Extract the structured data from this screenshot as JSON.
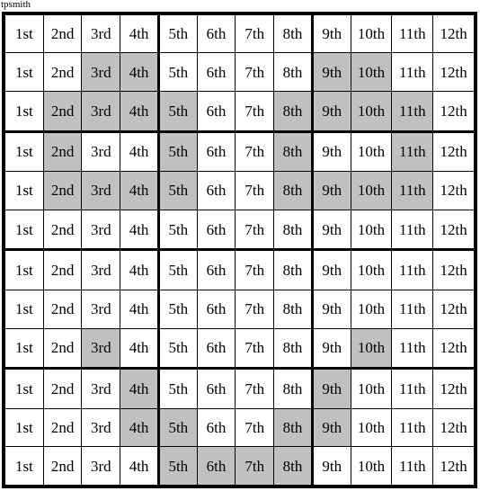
{
  "caption": "tpsmith",
  "colors": {
    "shaded": "#c0c0c0",
    "unshaded": "#ffffff",
    "border": "#000000"
  },
  "grid": {
    "rows": 12,
    "columns": 12,
    "column_labels": [
      "1st",
      "2nd",
      "3rd",
      "4th",
      "5th",
      "6th",
      "7th",
      "8th",
      "9th",
      "10th",
      "11th",
      "12th"
    ],
    "thick_column_separators_after": [
      4,
      8
    ],
    "thick_row_separators_after": [
      3,
      6,
      9
    ],
    "cells": [
      [
        {
          "label": "1st",
          "shaded": false
        },
        {
          "label": "2nd",
          "shaded": false
        },
        {
          "label": "3rd",
          "shaded": false
        },
        {
          "label": "4th",
          "shaded": false
        },
        {
          "label": "5th",
          "shaded": false
        },
        {
          "label": "6th",
          "shaded": false
        },
        {
          "label": "7th",
          "shaded": false
        },
        {
          "label": "8th",
          "shaded": false
        },
        {
          "label": "9th",
          "shaded": false
        },
        {
          "label": "10th",
          "shaded": false
        },
        {
          "label": "11th",
          "shaded": false
        },
        {
          "label": "12th",
          "shaded": false
        }
      ],
      [
        {
          "label": "1st",
          "shaded": false
        },
        {
          "label": "2nd",
          "shaded": false
        },
        {
          "label": "3rd",
          "shaded": true
        },
        {
          "label": "4th",
          "shaded": true
        },
        {
          "label": "5th",
          "shaded": false
        },
        {
          "label": "6th",
          "shaded": false
        },
        {
          "label": "7th",
          "shaded": false
        },
        {
          "label": "8th",
          "shaded": false
        },
        {
          "label": "9th",
          "shaded": true
        },
        {
          "label": "10th",
          "shaded": true
        },
        {
          "label": "11th",
          "shaded": false
        },
        {
          "label": "12th",
          "shaded": false
        }
      ],
      [
        {
          "label": "1st",
          "shaded": false
        },
        {
          "label": "2nd",
          "shaded": true
        },
        {
          "label": "3rd",
          "shaded": true
        },
        {
          "label": "4th",
          "shaded": true
        },
        {
          "label": "5th",
          "shaded": true
        },
        {
          "label": "6th",
          "shaded": false
        },
        {
          "label": "7th",
          "shaded": false
        },
        {
          "label": "8th",
          "shaded": true
        },
        {
          "label": "9th",
          "shaded": true
        },
        {
          "label": "10th",
          "shaded": true
        },
        {
          "label": "11th",
          "shaded": true
        },
        {
          "label": "12th",
          "shaded": false
        }
      ],
      [
        {
          "label": "1st",
          "shaded": false
        },
        {
          "label": "2nd",
          "shaded": true
        },
        {
          "label": "3rd",
          "shaded": false
        },
        {
          "label": "4th",
          "shaded": false
        },
        {
          "label": "5th",
          "shaded": true
        },
        {
          "label": "6th",
          "shaded": false
        },
        {
          "label": "7th",
          "shaded": false
        },
        {
          "label": "8th",
          "shaded": true
        },
        {
          "label": "9th",
          "shaded": false
        },
        {
          "label": "10th",
          "shaded": false
        },
        {
          "label": "11th",
          "shaded": true
        },
        {
          "label": "12th",
          "shaded": false
        }
      ],
      [
        {
          "label": "1st",
          "shaded": false
        },
        {
          "label": "2nd",
          "shaded": true
        },
        {
          "label": "3rd",
          "shaded": true
        },
        {
          "label": "4th",
          "shaded": true
        },
        {
          "label": "5th",
          "shaded": true
        },
        {
          "label": "6th",
          "shaded": false
        },
        {
          "label": "7th",
          "shaded": false
        },
        {
          "label": "8th",
          "shaded": true
        },
        {
          "label": "9th",
          "shaded": true
        },
        {
          "label": "10th",
          "shaded": true
        },
        {
          "label": "11th",
          "shaded": true
        },
        {
          "label": "12th",
          "shaded": false
        }
      ],
      [
        {
          "label": "1st",
          "shaded": false
        },
        {
          "label": "2nd",
          "shaded": false
        },
        {
          "label": "3rd",
          "shaded": false
        },
        {
          "label": "4th",
          "shaded": false
        },
        {
          "label": "5th",
          "shaded": false
        },
        {
          "label": "6th",
          "shaded": false
        },
        {
          "label": "7th",
          "shaded": false
        },
        {
          "label": "8th",
          "shaded": false
        },
        {
          "label": "9th",
          "shaded": false
        },
        {
          "label": "10th",
          "shaded": false
        },
        {
          "label": "11th",
          "shaded": false
        },
        {
          "label": "12th",
          "shaded": false
        }
      ],
      [
        {
          "label": "1st",
          "shaded": false
        },
        {
          "label": "2nd",
          "shaded": false
        },
        {
          "label": "3rd",
          "shaded": false
        },
        {
          "label": "4th",
          "shaded": false
        },
        {
          "label": "5th",
          "shaded": false
        },
        {
          "label": "6th",
          "shaded": false
        },
        {
          "label": "7th",
          "shaded": false
        },
        {
          "label": "8th",
          "shaded": false
        },
        {
          "label": "9th",
          "shaded": false
        },
        {
          "label": "10th",
          "shaded": false
        },
        {
          "label": "11th",
          "shaded": false
        },
        {
          "label": "12th",
          "shaded": false
        }
      ],
      [
        {
          "label": "1st",
          "shaded": false
        },
        {
          "label": "2nd",
          "shaded": false
        },
        {
          "label": "3rd",
          "shaded": false
        },
        {
          "label": "4th",
          "shaded": false
        },
        {
          "label": "5th",
          "shaded": false
        },
        {
          "label": "6th",
          "shaded": false
        },
        {
          "label": "7th",
          "shaded": false
        },
        {
          "label": "8th",
          "shaded": false
        },
        {
          "label": "9th",
          "shaded": false
        },
        {
          "label": "10th",
          "shaded": false
        },
        {
          "label": "11th",
          "shaded": false
        },
        {
          "label": "12th",
          "shaded": false
        }
      ],
      [
        {
          "label": "1st",
          "shaded": false
        },
        {
          "label": "2nd",
          "shaded": false
        },
        {
          "label": "3rd",
          "shaded": true
        },
        {
          "label": "4th",
          "shaded": false
        },
        {
          "label": "5th",
          "shaded": false
        },
        {
          "label": "6th",
          "shaded": false
        },
        {
          "label": "7th",
          "shaded": false
        },
        {
          "label": "8th",
          "shaded": false
        },
        {
          "label": "9th",
          "shaded": false
        },
        {
          "label": "10th",
          "shaded": true
        },
        {
          "label": "11th",
          "shaded": false
        },
        {
          "label": "12th",
          "shaded": false
        }
      ],
      [
        {
          "label": "1st",
          "shaded": false
        },
        {
          "label": "2nd",
          "shaded": false
        },
        {
          "label": "3rd",
          "shaded": false
        },
        {
          "label": "4th",
          "shaded": true
        },
        {
          "label": "5th",
          "shaded": false
        },
        {
          "label": "6th",
          "shaded": false
        },
        {
          "label": "7th",
          "shaded": false
        },
        {
          "label": "8th",
          "shaded": false
        },
        {
          "label": "9th",
          "shaded": true
        },
        {
          "label": "10th",
          "shaded": false
        },
        {
          "label": "11th",
          "shaded": false
        },
        {
          "label": "12th",
          "shaded": false
        }
      ],
      [
        {
          "label": "1st",
          "shaded": false
        },
        {
          "label": "2nd",
          "shaded": false
        },
        {
          "label": "3rd",
          "shaded": false
        },
        {
          "label": "4th",
          "shaded": true
        },
        {
          "label": "5th",
          "shaded": true
        },
        {
          "label": "6th",
          "shaded": false
        },
        {
          "label": "7th",
          "shaded": false
        },
        {
          "label": "8th",
          "shaded": true
        },
        {
          "label": "9th",
          "shaded": true
        },
        {
          "label": "10th",
          "shaded": false
        },
        {
          "label": "11th",
          "shaded": false
        },
        {
          "label": "12th",
          "shaded": false
        }
      ],
      [
        {
          "label": "1st",
          "shaded": false
        },
        {
          "label": "2nd",
          "shaded": false
        },
        {
          "label": "3rd",
          "shaded": false
        },
        {
          "label": "4th",
          "shaded": false
        },
        {
          "label": "5th",
          "shaded": true
        },
        {
          "label": "6th",
          "shaded": true
        },
        {
          "label": "7th",
          "shaded": true
        },
        {
          "label": "8th",
          "shaded": true
        },
        {
          "label": "9th",
          "shaded": false
        },
        {
          "label": "10th",
          "shaded": false
        },
        {
          "label": "11th",
          "shaded": false
        },
        {
          "label": "12th",
          "shaded": false
        }
      ]
    ]
  }
}
